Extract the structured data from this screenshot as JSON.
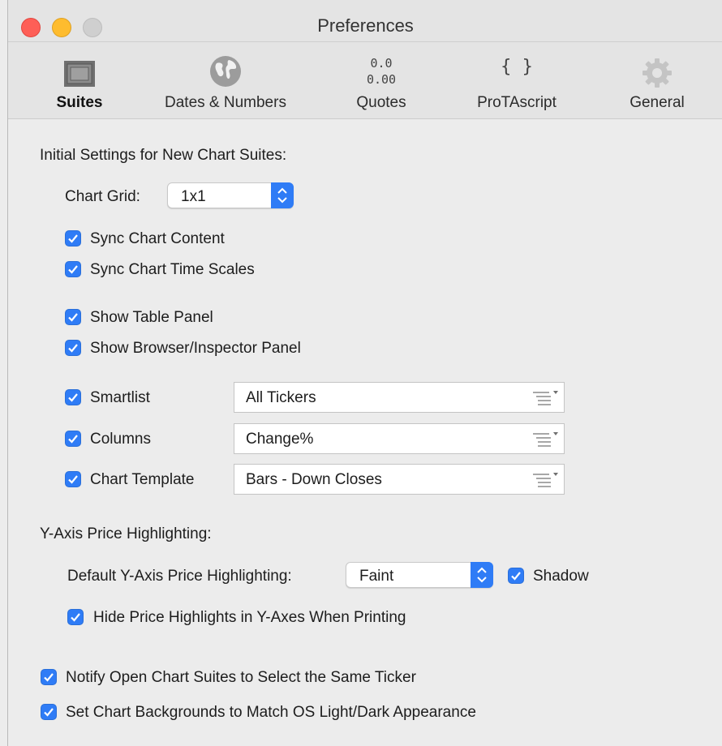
{
  "window": {
    "title": "Preferences"
  },
  "toolbar": {
    "items": [
      {
        "label": "Suites",
        "icon": "suites-icon",
        "active": true
      },
      {
        "label": "Dates & Numbers",
        "icon": "globe-icon",
        "active": false
      },
      {
        "label": "Quotes",
        "icon": "quotes-icon",
        "active": false,
        "icon_line1": "0.0",
        "icon_line2": "0.00"
      },
      {
        "label": "ProTAscript",
        "icon": "braces-icon",
        "active": false,
        "icon_text": "{ }"
      },
      {
        "label": "General",
        "icon": "gear-icon",
        "active": false
      }
    ]
  },
  "suites": {
    "heading": "Initial Settings for New Chart Suites:",
    "chart_grid": {
      "label": "Chart Grid:",
      "value": "1x1"
    },
    "checkboxes": {
      "sync_content": {
        "label": "Sync Chart Content",
        "checked": true
      },
      "sync_time": {
        "label": "Sync Chart Time Scales",
        "checked": true
      },
      "show_table": {
        "label": "Show Table Panel",
        "checked": true
      },
      "show_browser": {
        "label": "Show Browser/Inspector Panel",
        "checked": true
      }
    },
    "smartlist": {
      "label": "Smartlist",
      "checked": true,
      "value": "All Tickers"
    },
    "columns": {
      "label": "Columns",
      "checked": true,
      "value": "Change%"
    },
    "template": {
      "label": "Chart Template",
      "checked": true,
      "value": "Bars - Down Closes"
    }
  },
  "yaxis": {
    "heading": "Y-Axis Price Highlighting:",
    "default_label": "Default Y-Axis Price Highlighting:",
    "default_value": "Faint",
    "shadow": {
      "label": "Shadow",
      "checked": true
    },
    "hide_printing": {
      "label": "Hide Price Highlights in Y-Axes When Printing",
      "checked": true
    }
  },
  "global": {
    "notify": {
      "label": "Notify Open Chart Suites to Select the Same Ticker",
      "checked": true
    },
    "backgrounds": {
      "label": "Set Chart Backgrounds to Match OS Light/Dark Appearance",
      "checked": true
    }
  },
  "colors": {
    "accent": "#2f7cf6",
    "close": "#fe5f57",
    "minimize": "#febc2e",
    "zoom": "#cfcfcf"
  }
}
